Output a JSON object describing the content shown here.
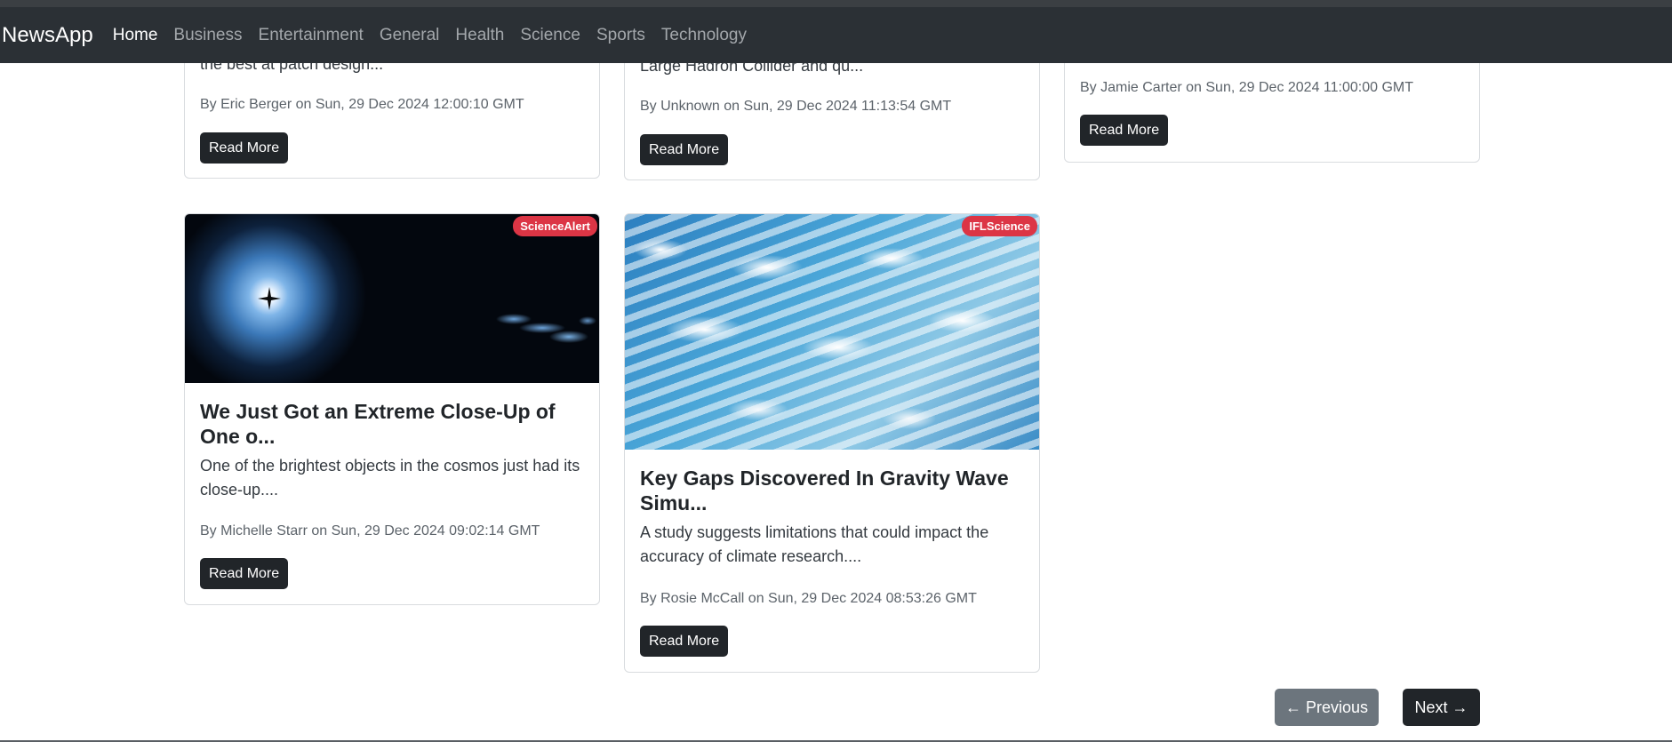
{
  "navbar": {
    "brand": "NewsApp",
    "links": [
      "Home",
      "Business",
      "Entertainment",
      "General",
      "Health",
      "Science",
      "Sports",
      "Technology"
    ],
    "active": "Home"
  },
  "cards": {
    "c1": {
      "excerpt_tail": "the best at patch design...",
      "meta": "By Eric Berger on Sun, 29 Dec 2024 12:00:10 GMT",
      "button": "Read More"
    },
    "c2": {
      "excerpt_tail": "Large Hadron Collider and qu...",
      "meta": "By Unknown on Sun, 29 Dec 2024 11:13:54 GMT",
      "button": "Read More"
    },
    "c3": {
      "meta": "By Jamie Carter on Sun, 29 Dec 2024 11:00:00 GMT",
      "button": "Read More"
    },
    "c4": {
      "source": "ScienceAlert",
      "title": "We Just Got an Extreme Close-Up of One o...",
      "excerpt": "One of the brightest objects in the cosmos just had its close-up....",
      "meta": "By Michelle Starr on Sun, 29 Dec 2024 09:02:14 GMT",
      "button": "Read More"
    },
    "c5": {
      "source": "IFLScience",
      "title": "Key Gaps Discovered In Gravity Wave Simu...",
      "excerpt": "A study suggests limitations that could impact the accuracy of climate research....",
      "meta": "By Rosie McCall on Sun, 29 Dec 2024 08:53:26 GMT",
      "button": "Read More"
    }
  },
  "pagination": {
    "previous": "← Previous",
    "next": "Next →"
  },
  "colors": {
    "navbar": "#2b3035",
    "badge": "#dc3545",
    "button_dark": "#212529",
    "button_secondary": "#6c757d"
  }
}
